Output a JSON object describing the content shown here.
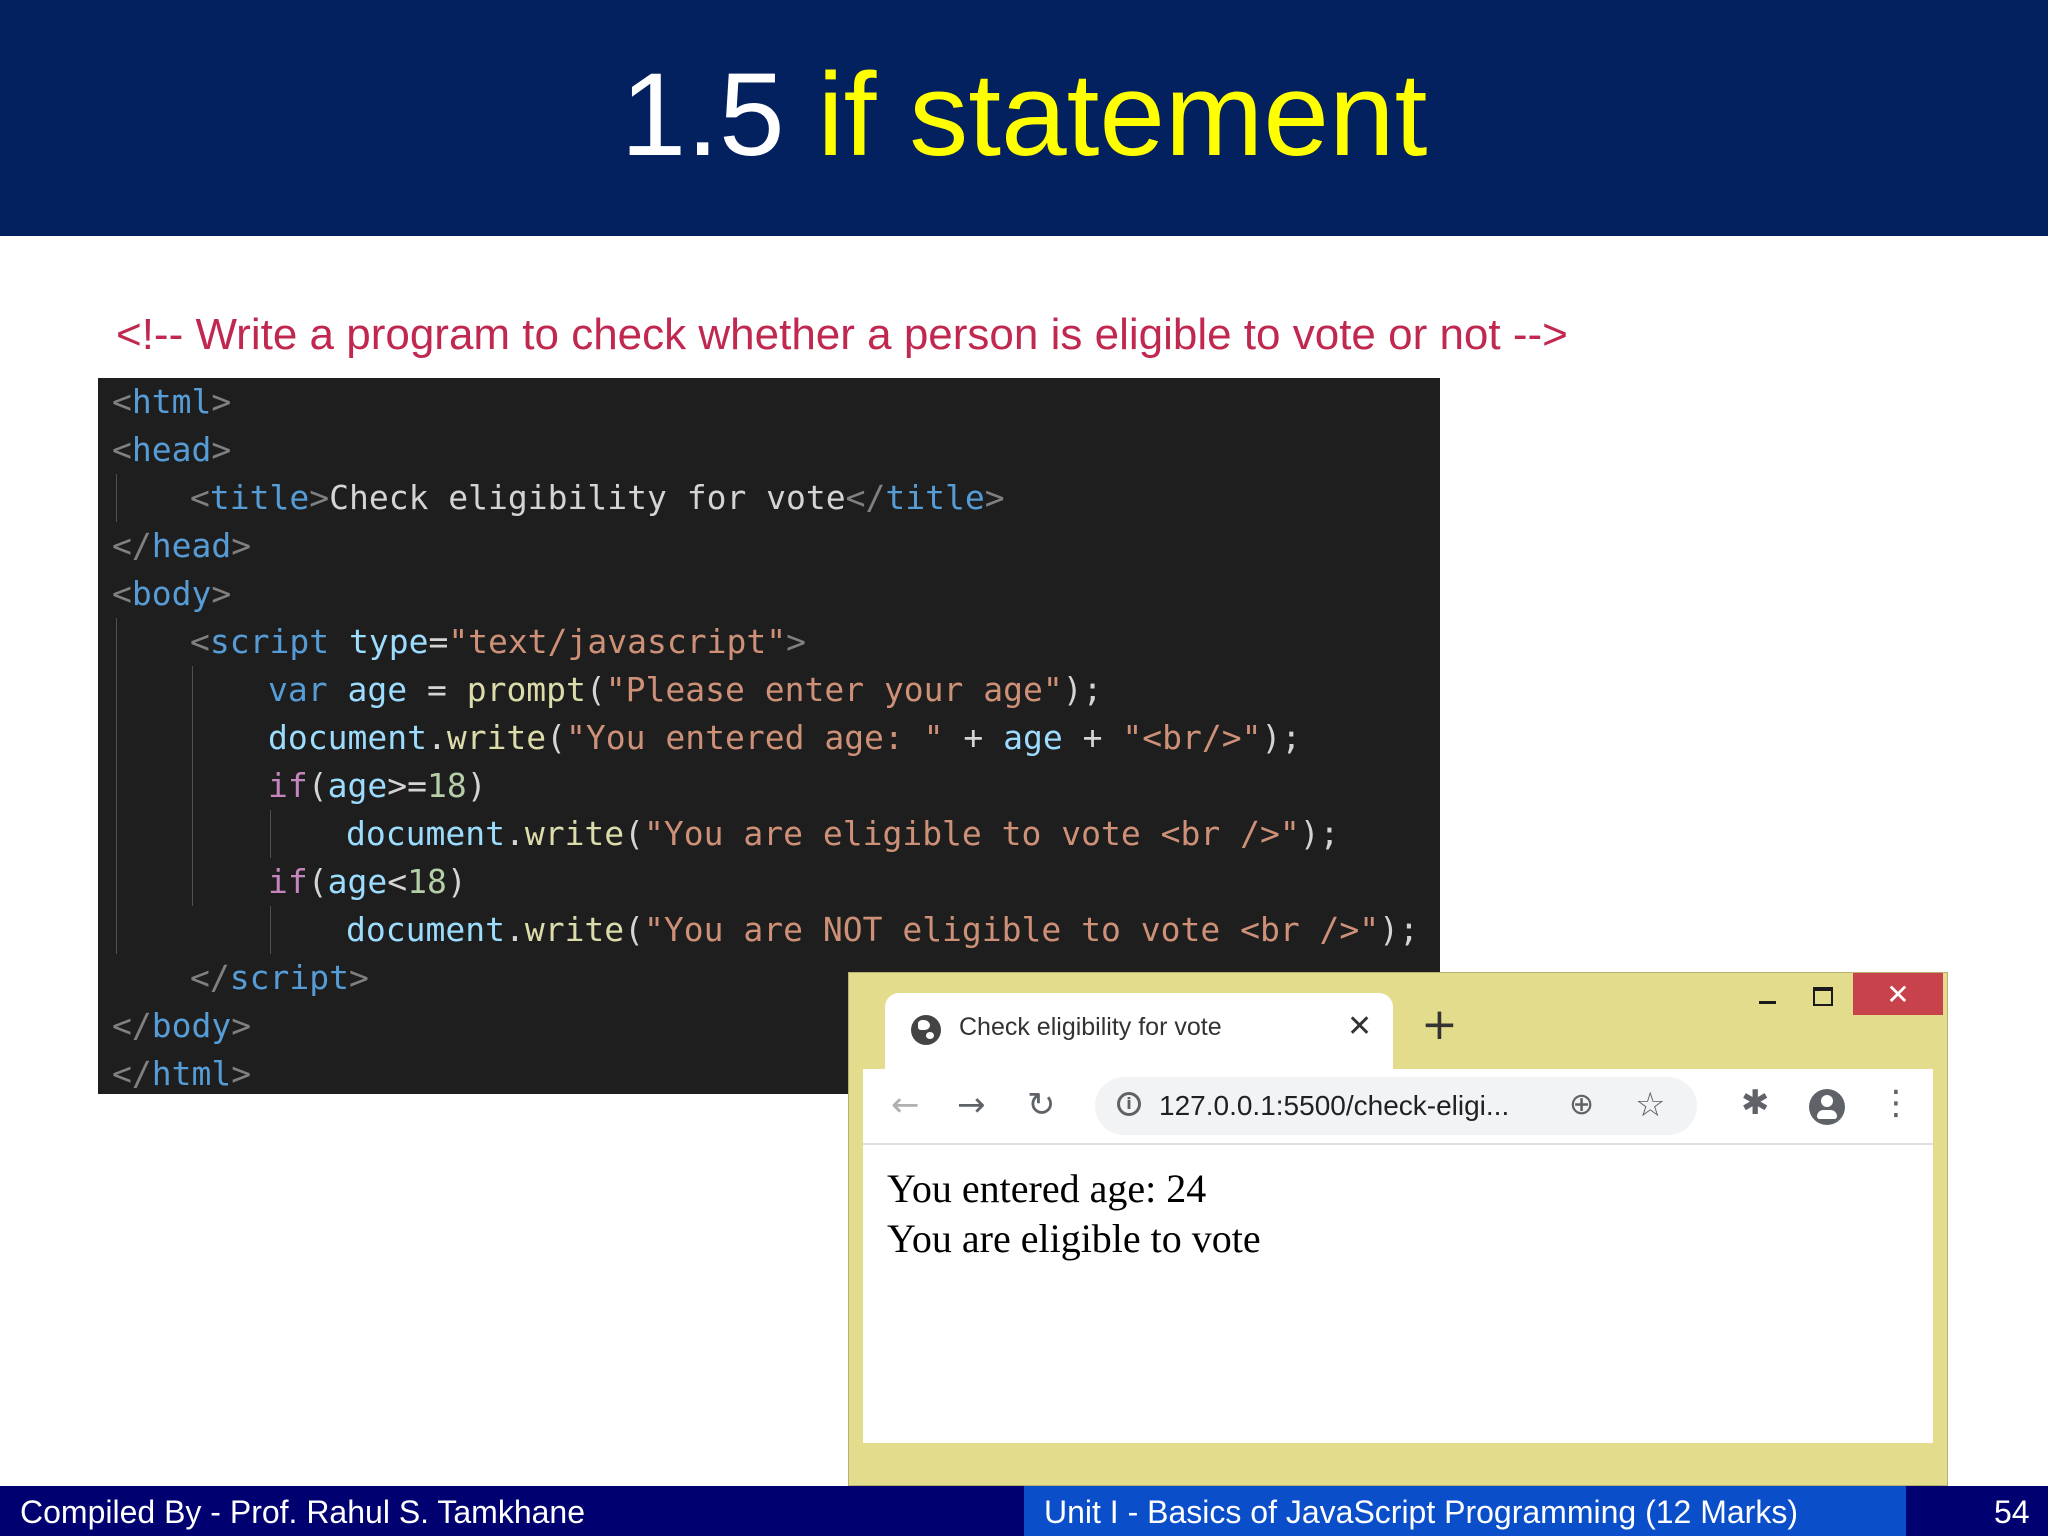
{
  "slide": {
    "title_number": "1.5",
    "title_rest": "if statement",
    "subtitle": "<!-- Write a program to check whether a person is eligible to vote or not -->"
  },
  "code": {
    "line1": {
      "open": "<",
      "tag": "html",
      "close": ">"
    },
    "line2": {
      "open": "<",
      "tag": "head",
      "close": ">"
    },
    "line3": {
      "open1": "<",
      "tag1": "title",
      "close1": ">",
      "text": "Check eligibility for vote",
      "open2": "</",
      "tag2": "title",
      "close2": ">"
    },
    "line4": {
      "open": "</",
      "tag": "head",
      "close": ">"
    },
    "line5": {
      "open": "<",
      "tag": "body",
      "close": ">"
    },
    "line6": {
      "open": "<",
      "tag": "script",
      "attr": " type",
      "eq": "=",
      "value": "\"text/javascript\"",
      "close": ">"
    },
    "line7": {
      "kw": "var",
      "var": " age",
      "op": " = ",
      "fn": "prompt",
      "p1": "(",
      "str": "\"Please enter your age\"",
      "p2": ");"
    },
    "line8": {
      "obj": "document",
      "dot": ".",
      "fn": "write",
      "p1": "(",
      "str1": "\"You entered age: \"",
      "op1": " + ",
      "var": "age",
      "op2": " + ",
      "str2": "\"<br/>\"",
      "p2": ");"
    },
    "line9": {
      "kw": "if",
      "p1": "(",
      "var": "age",
      "op": ">=",
      "num": "18",
      "p2": ")"
    },
    "line10": {
      "obj": "document",
      "dot": ".",
      "fn": "write",
      "p1": "(",
      "str": "\"You are eligible to vote <br />\"",
      "p2": ");"
    },
    "line11": {
      "kw": "if",
      "p1": "(",
      "var": "age",
      "op": "<",
      "num": "18",
      "p2": ")"
    },
    "line12": {
      "obj": "document",
      "dot": ".",
      "fn": "write",
      "p1": "(",
      "str": "\"You are NOT eligible to vote <br />\"",
      "p2": ");"
    },
    "line13": {
      "open": "</",
      "tag": "script",
      "close": ">"
    },
    "line14": {
      "open": "</",
      "tag": "body",
      "close": ">"
    },
    "line15": {
      "open": "</",
      "tag": "html",
      "close": ">"
    }
  },
  "browser": {
    "tab_title": "Check eligibility for vote",
    "tab_close": "✕",
    "new_tab": "+",
    "url": "127.0.0.1:5500/check-eligi...",
    "window_close": "✕",
    "output_line1": "You entered age: 24",
    "output_line2": "You are eligible to vote",
    "icons": [
      "globe-icon",
      "back-arrow-icon",
      "forward-arrow-icon",
      "reload-icon",
      "info-icon",
      "zoom-icon",
      "star-icon",
      "extensions-icon",
      "profile-icon",
      "menu-icon"
    ]
  },
  "footer": {
    "left": "Compiled By - Prof. Rahul S. Tamkhane",
    "middle": "Unit  I - Basics of JavaScript Programming (12 Marks)",
    "page_number": "54"
  },
  "colors": {
    "header_bg": "#03205f",
    "title_accent": "#ffff00",
    "subtitle": "#c0284f",
    "code_bg": "#1e1e1e",
    "browser_frame": "#e3dc8c",
    "footer_dark": "#000070",
    "footer_blue": "#0a4fc9"
  }
}
